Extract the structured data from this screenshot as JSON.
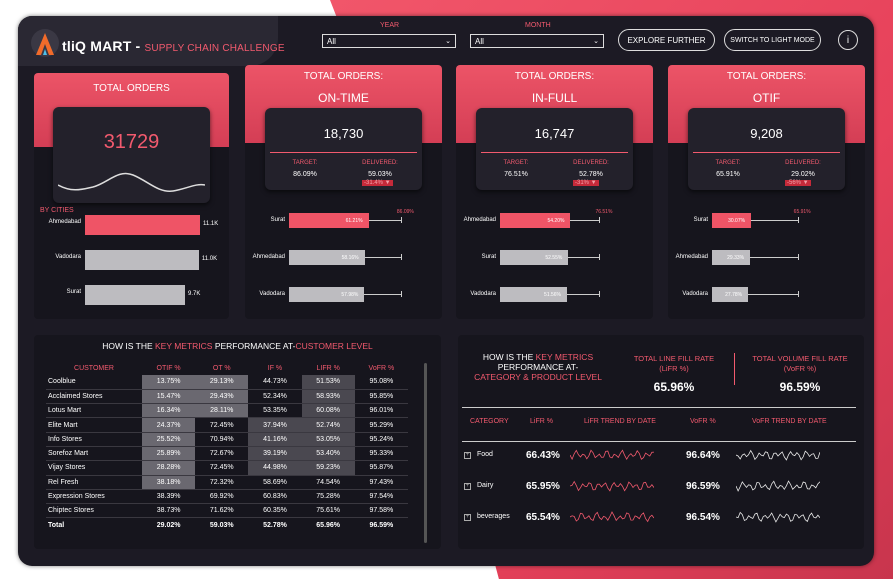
{
  "header": {
    "brand": "tliQ MART",
    "sep": " - ",
    "subtitle": "SUPPLY CHAIN CHALLENGE",
    "year_label": "YEAR",
    "year_value": "All",
    "month_label": "MONTH",
    "month_value": "All",
    "explore": "EXPLORE FURTHER",
    "light_mode": "SWITCH TO LIGHT MODE",
    "info": "i"
  },
  "cards": {
    "total": {
      "title": "TOTAL ORDERS",
      "value": "31729",
      "by": "BY CITIES",
      "rows": [
        {
          "label": "Ahmedabad",
          "val": "11.1K",
          "frac": 1.0
        },
        {
          "label": "Vadodara",
          "val": "11.0K",
          "frac": 0.99
        },
        {
          "label": "Surat",
          "val": "9.7K",
          "frac": 0.87
        }
      ]
    },
    "ontime": {
      "title1": "TOTAL ORDERS:",
      "title2": "ON-TIME",
      "value": "18,730",
      "target_label": "TARGET:",
      "delivered_label": "DELIVERED:",
      "target": "86.09%",
      "delivered": "59.03%",
      "delta": "-31.4% ▼",
      "target_mark": "86.09%",
      "rows": [
        {
          "label": "Surat",
          "pct": "61.21%",
          "frac": 0.6121
        },
        {
          "label": "Ahmedabad",
          "pct": "58.16%",
          "frac": 0.5816
        },
        {
          "label": "Vadodara",
          "pct": "57.98%",
          "frac": 0.5798
        }
      ]
    },
    "infull": {
      "title1": "TOTAL ORDERS:",
      "title2": "IN-FULL",
      "value": "16,747",
      "target_label": "TARGET:",
      "delivered_label": "DELIVERED:",
      "target": "76.51%",
      "delivered": "52.78%",
      "delta": "-31% ▼",
      "target_mark": "76.51%",
      "rows": [
        {
          "label": "Ahmedabad",
          "pct": "54.20%",
          "frac": 0.542
        },
        {
          "label": "Surat",
          "pct": "52.55%",
          "frac": 0.5255
        },
        {
          "label": "Vadodara",
          "pct": "51.56%",
          "frac": 0.5156
        }
      ]
    },
    "otif": {
      "title1": "TOTAL ORDERS:",
      "title2": "OTIF",
      "value": "9,208",
      "target_label": "TARGET:",
      "delivered_label": "DELIVERED:",
      "target": "65.91%",
      "delivered": "29.02%",
      "delta": "-56% ▼",
      "target_mark": "65.91%",
      "rows": [
        {
          "label": "Surat",
          "pct": "30.07%",
          "frac": 0.3007
        },
        {
          "label": "Ahmedabad",
          "pct": "29.33%",
          "frac": 0.2933
        },
        {
          "label": "Vadodara",
          "pct": "27.78%",
          "frac": 0.2778
        }
      ]
    }
  },
  "customer": {
    "title_a": "HOW IS THE ",
    "title_b": "KEY METRICS",
    "title_c": " PERFORMANCE AT-",
    "title_d": "CUSTOMER LEVEL",
    "cols": [
      "CUSTOMER",
      "OTIF %",
      "OT %",
      "IF %",
      "LIFR %",
      "VoFR %"
    ],
    "rows": [
      [
        "Coolblue",
        "13.75%",
        "29.13%",
        "44.73%",
        "51.53%",
        "95.08%"
      ],
      [
        "Acclaimed Stores",
        "15.47%",
        "29.43%",
        "52.34%",
        "58.93%",
        "95.85%"
      ],
      [
        "Lotus Mart",
        "16.34%",
        "28.11%",
        "53.35%",
        "60.08%",
        "96.01%"
      ],
      [
        "Elite Mart",
        "24.37%",
        "72.45%",
        "37.94%",
        "52.74%",
        "95.29%"
      ],
      [
        "Info Stores",
        "25.52%",
        "70.94%",
        "41.16%",
        "53.05%",
        "95.24%"
      ],
      [
        "Sorefoz Mart",
        "25.89%",
        "72.67%",
        "39.19%",
        "53.40%",
        "95.33%"
      ],
      [
        "Vijay Stores",
        "28.28%",
        "72.45%",
        "44.98%",
        "59.23%",
        "95.87%"
      ],
      [
        "Rel Fresh",
        "38.18%",
        "72.32%",
        "58.69%",
        "74.54%",
        "97.43%"
      ],
      [
        "Expression Stores",
        "38.39%",
        "69.92%",
        "60.83%",
        "75.28%",
        "97.54%"
      ],
      [
        "Chiptec Stores",
        "38.73%",
        "71.62%",
        "60.35%",
        "75.61%",
        "97.58%"
      ]
    ],
    "total": [
      "Total",
      "29.02%",
      "59.03%",
      "52.78%",
      "65.96%",
      "96.59%"
    ]
  },
  "category": {
    "title_a": "HOW IS THE ",
    "title_b": "KEY METRICS",
    "title_c": "PERFORMANCE AT-",
    "title_d": "CATEGORY & PRODUCT LEVEL",
    "lifr_label1": "TOTAL LINE FILL RATE",
    "lifr_label2": "(LiFR %)",
    "lifr": "65.96%",
    "vofr_label1": "TOTAL VOLUME FILL RATE",
    "vofr_label2": "(VoFR %)",
    "vofr": "96.59%",
    "cols": [
      "CATEGORY",
      "LiFR %",
      "LiFR TREND BY DATE",
      "VoFR %",
      "VoFR TREND BY DATE"
    ],
    "rows": [
      {
        "name": "Food",
        "lifr": "66.43%",
        "vofr": "96.64%"
      },
      {
        "name": "Dairy",
        "lifr": "65.95%",
        "vofr": "96.59%"
      },
      {
        "name": "beverages",
        "lifr": "65.54%",
        "vofr": "96.54%"
      }
    ]
  },
  "colors": {
    "accent": "#f25a6e",
    "bar_accent": "#ef5466",
    "bar_grey": "#bdbcc0"
  }
}
